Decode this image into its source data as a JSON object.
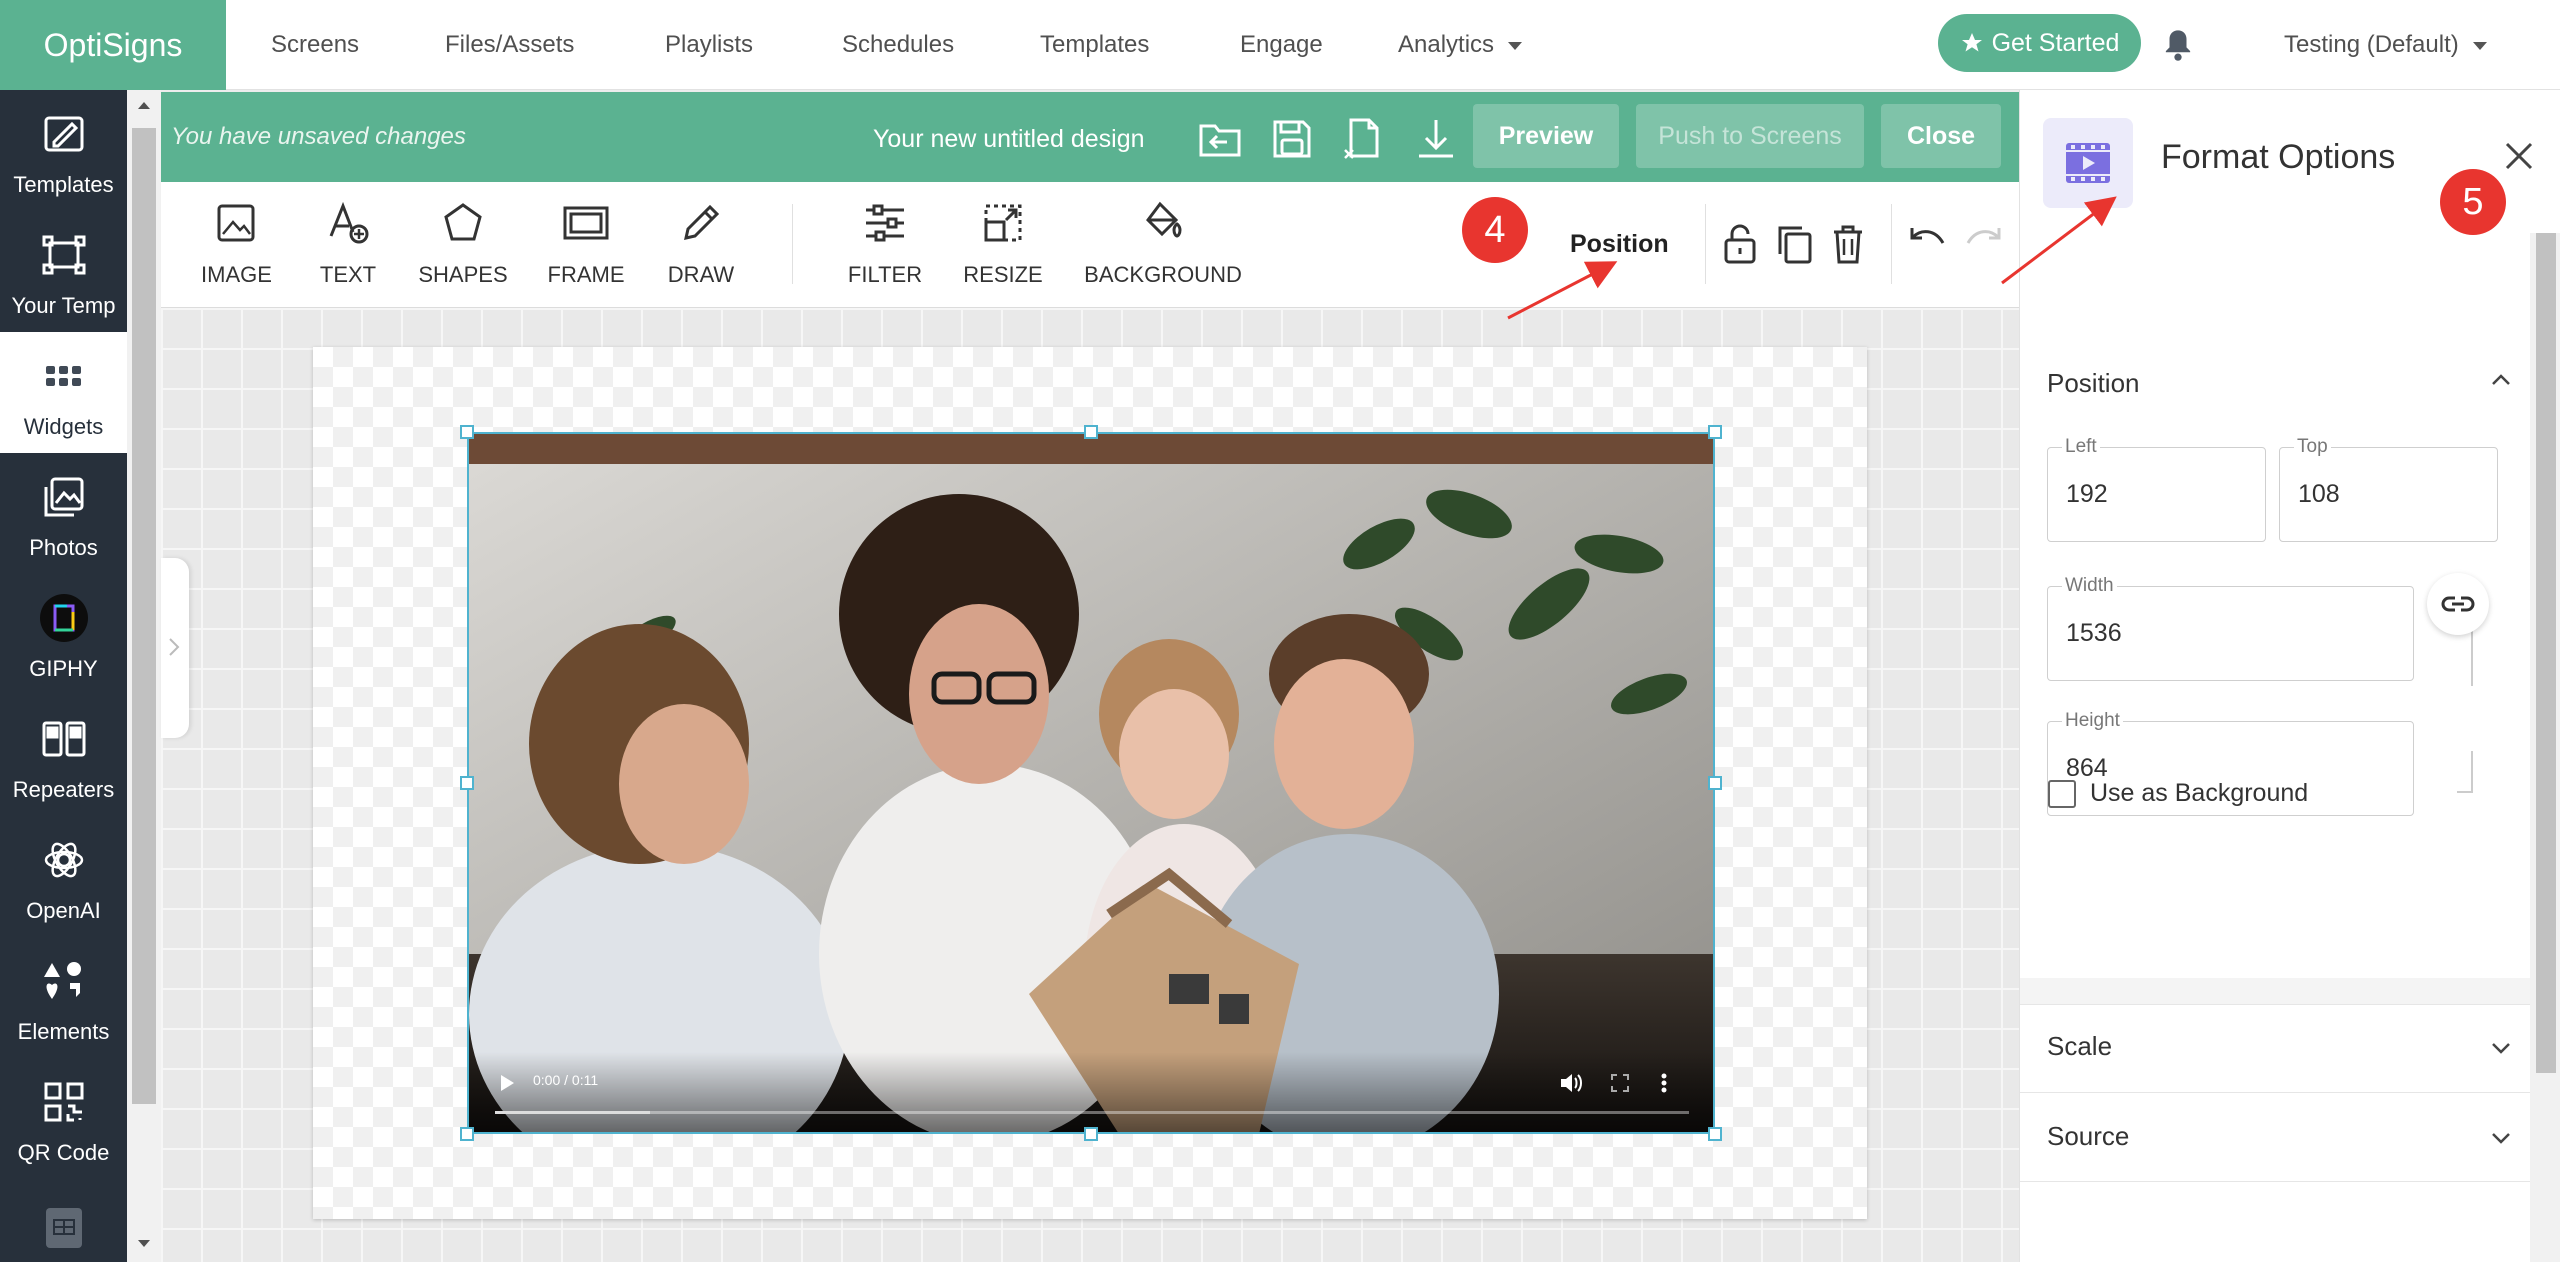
{
  "topnav": {
    "brand": "OptiSigns",
    "links": [
      "Screens",
      "Files/Assets",
      "Playlists",
      "Schedules",
      "Templates",
      "Engage",
      "Analytics"
    ],
    "get_started": "Get Started",
    "account": "Testing (Default)"
  },
  "sidebar": {
    "items": [
      {
        "label": "Templates",
        "icon": "templates-icon"
      },
      {
        "label": "Your Temp",
        "icon": "your-templates-icon"
      },
      {
        "label": "Widgets",
        "icon": "widgets-icon",
        "active": true
      },
      {
        "label": "Photos",
        "icon": "photos-icon"
      },
      {
        "label": "GIPHY",
        "icon": "giphy-icon"
      },
      {
        "label": "Repeaters",
        "icon": "repeaters-icon"
      },
      {
        "label": "OpenAI",
        "icon": "openai-icon"
      },
      {
        "label": "Elements",
        "icon": "elements-icon"
      },
      {
        "label": "QR Code",
        "icon": "qr-code-icon"
      }
    ]
  },
  "designbar": {
    "unsaved": "You have unsaved changes",
    "title": "Your new untitled design",
    "preview": "Preview",
    "push": "Push to Screens",
    "close": "Close"
  },
  "toolbar": {
    "tools": [
      "IMAGE",
      "TEXT",
      "SHAPES",
      "FRAME",
      "DRAW",
      "FILTER",
      "RESIZE",
      "BACKGROUND"
    ],
    "position": "Position"
  },
  "markers": {
    "four": "4",
    "five": "5"
  },
  "video": {
    "time": "0:00 / 0:11",
    "progress": 0.13
  },
  "format_panel": {
    "title": "Format Options",
    "position_section": "Position",
    "left_label": "Left",
    "left_value": "192",
    "top_label": "Top",
    "top_value": "108",
    "width_label": "Width",
    "width_value": "1536",
    "height_label": "Height",
    "height_value": "864",
    "use_bg": "Use as Background",
    "use_bg_checked": false,
    "scale_section": "Scale",
    "source_section": "Source"
  },
  "colors": {
    "brand_green": "#5bb291",
    "sidebar_dark": "#27303b",
    "marker_red": "#e8352f",
    "selection_blue": "#4fb3cf",
    "panel_icon_purple": "#7b6fe0"
  }
}
